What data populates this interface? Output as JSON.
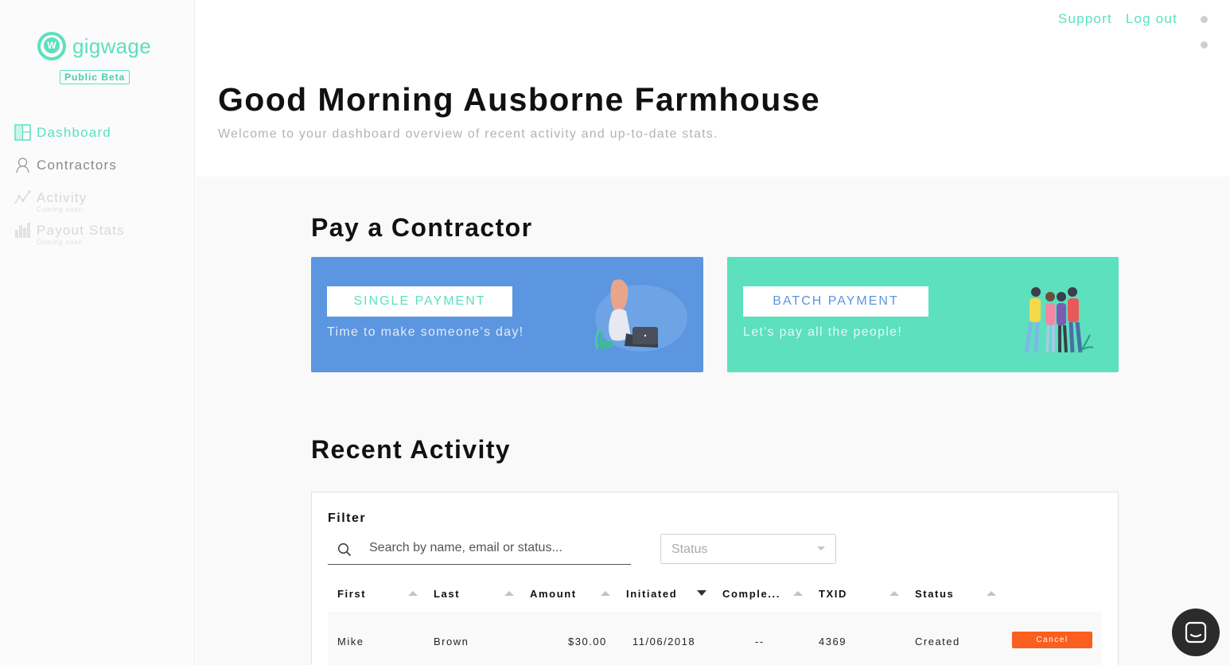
{
  "brand": {
    "name": "gigwage",
    "badge": "Public Beta",
    "accent": "#5ce0be",
    "blue": "#5c95e0",
    "orange": "#fb5f1f"
  },
  "sidebar": {
    "items": [
      {
        "label": "Dashboard",
        "icon": "dashboard-icon",
        "sub": ""
      },
      {
        "label": "Contractors",
        "icon": "user-icon",
        "sub": ""
      },
      {
        "label": "Activity",
        "icon": "activity-icon",
        "sub": "Coming soon..."
      },
      {
        "label": "Payout Stats",
        "icon": "bar-chart-icon",
        "sub": "Coming soon..."
      }
    ]
  },
  "header": {
    "support": "Support",
    "logout": "Log out"
  },
  "main": {
    "greeting": "Good Morning Ausborne Farmhouse",
    "subtitle": "Welcome to your dashboard overview of recent activity and up-to-date stats.",
    "pay_title": "Pay a Contractor",
    "single": {
      "button": "SINGLE PAYMENT",
      "desc": "Time to make someone's day!"
    },
    "batch": {
      "button": "BATCH PAYMENT",
      "desc": "Let's pay all the people!"
    },
    "recent_title": "Recent Activity"
  },
  "filter": {
    "label": "Filter",
    "search_placeholder": "Search by name, email or status...",
    "status_placeholder": "Status"
  },
  "table": {
    "columns": [
      "First",
      "Last",
      "Amount",
      "Initiated",
      "Comple...",
      "TXID",
      "Status"
    ],
    "rows": [
      {
        "first": "Mike",
        "last": "Brown",
        "amount": "$30.00",
        "initiated": "11/06/2018",
        "completed": "--",
        "txid": "4369",
        "status": "Created",
        "action": "Cancel"
      }
    ]
  }
}
